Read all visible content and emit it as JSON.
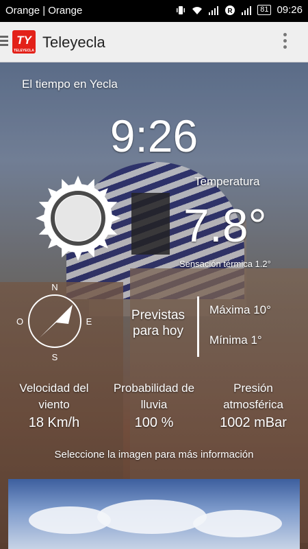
{
  "status_bar": {
    "carrier": "Orange | Orange",
    "battery": "81",
    "time": "09:26"
  },
  "app_bar": {
    "logo_text": "TY",
    "logo_subtext": "TELEYECLA",
    "title": "Teleyecla"
  },
  "weather": {
    "location_title": "El tiempo en Yecla",
    "clock": "9:26",
    "temperature_label": "Temperatura",
    "temperature": "7.8°",
    "feels_like": "Sensación térmica 1.2°",
    "forecast_label": "Previstas para hoy",
    "max": "Máxima 10°",
    "min": "Mínima 1°",
    "compass": {
      "n": "N",
      "s": "S",
      "e": "E",
      "o": "O"
    },
    "stats": [
      {
        "label": "Velocidad del viento",
        "value": "18 Km/h"
      },
      {
        "label": "Probabilidad de lluvia",
        "value": "100 %"
      },
      {
        "label": "Presión atmosférica",
        "value": "1002 mBar"
      }
    ],
    "hint": "Seleccione la imagen para más información"
  },
  "icons": [
    "hamburger-icon",
    "overflow-menu-icon",
    "sun-icon",
    "compass-icon",
    "wifi-icon",
    "signal-icon",
    "vibrate-icon",
    "r-icon"
  ]
}
